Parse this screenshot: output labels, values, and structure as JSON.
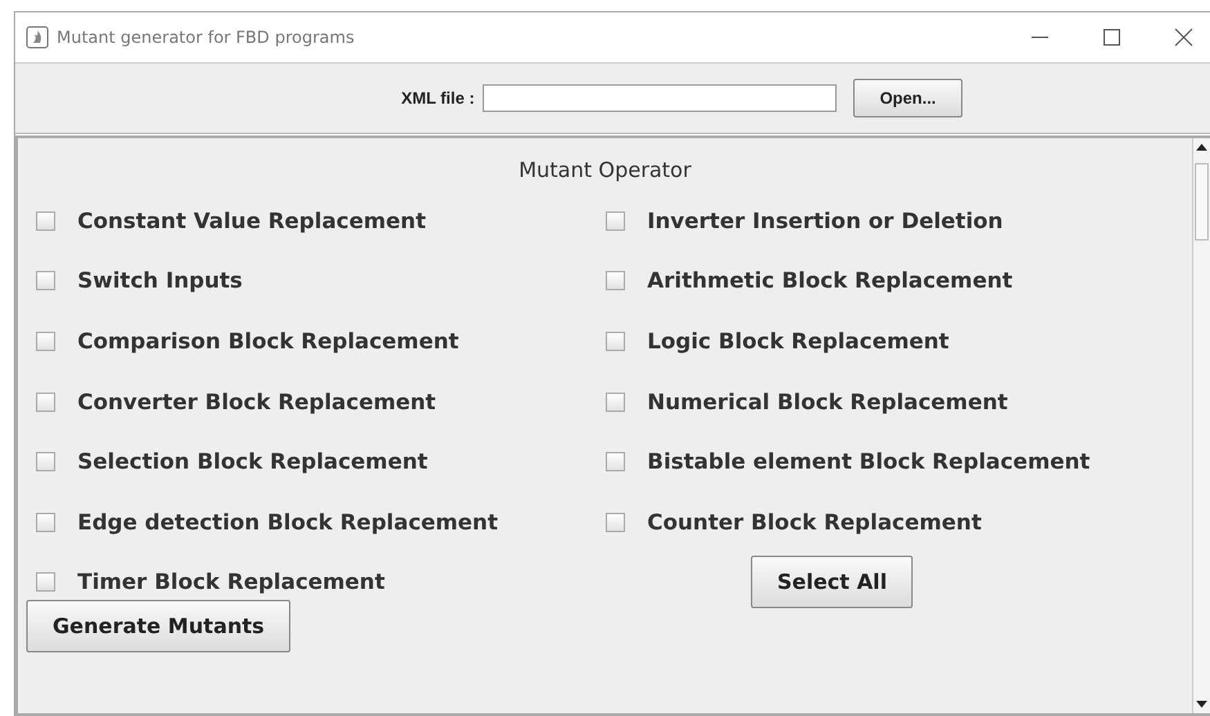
{
  "window": {
    "title": "Mutant generator for FBD programs"
  },
  "file_bar": {
    "label": "XML file :",
    "open_button": "Open..."
  },
  "panel": {
    "heading": "Mutant Operator",
    "left_options": [
      {
        "label": "Constant Value Replacement",
        "checked": false
      },
      {
        "label": "Switch Inputs",
        "checked": false
      },
      {
        "label": "Comparison Block Replacement",
        "checked": false
      },
      {
        "label": "Converter Block Replacement",
        "checked": false
      },
      {
        "label": "Selection Block Replacement",
        "checked": false
      },
      {
        "label": "Edge detection Block Replacement",
        "checked": false
      },
      {
        "label": "Timer Block Replacement",
        "checked": false
      }
    ],
    "right_options": [
      {
        "label": "Inverter Insertion or Deletion",
        "checked": false
      },
      {
        "label": "Arithmetic Block Replacement",
        "checked": false
      },
      {
        "label": "Logic Block Replacement",
        "checked": false
      },
      {
        "label": "Numerical Block Replacement",
        "checked": false
      },
      {
        "label": "Bistable element Block Replacement",
        "checked": false
      },
      {
        "label": "Counter Block Replacement",
        "checked": false
      }
    ],
    "select_all_button": "Select All",
    "generate_button": "Generate Mutants"
  }
}
